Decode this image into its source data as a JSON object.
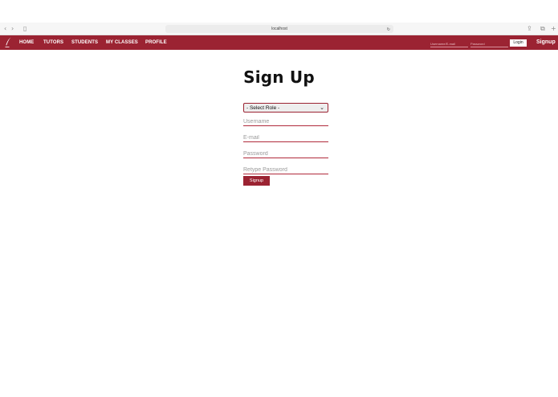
{
  "browser": {
    "url": "localhost",
    "back": "‹",
    "forward": "›",
    "sidebar": "▯",
    "reload": "↻",
    "share": "⇪",
    "tabs": "⧉",
    "new_tab": "+"
  },
  "navbar": {
    "links": [
      "HOME",
      "TUTORS",
      "STUDENTS",
      "MY CLASSES",
      "PROFILE"
    ],
    "username_placeholder": "Username/E-mail",
    "password_placeholder": "Password",
    "login_label": "Login",
    "signup_label": "Signup",
    "brand_color": "#9b2332"
  },
  "form": {
    "title": "Sign Up",
    "role_value": "- Select Role -",
    "username_placeholder": "Username",
    "email_placeholder": "E-mail",
    "password_placeholder": "Password",
    "retype_placeholder": "Retype Password",
    "submit_label": "Signup"
  }
}
